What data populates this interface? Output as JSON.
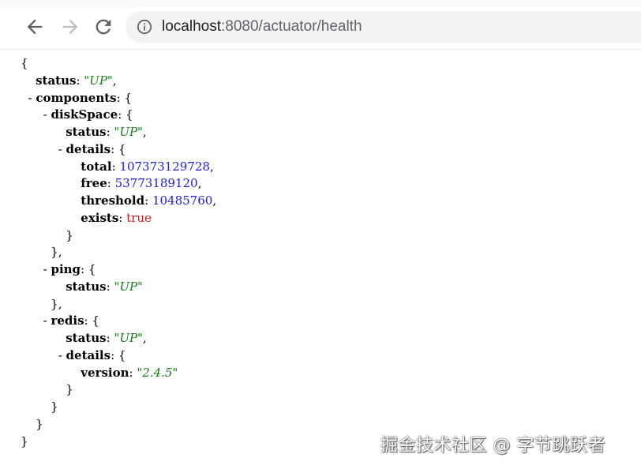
{
  "browser": {
    "url_host": "localhost",
    "url_rest": ":8080/actuator/health"
  },
  "json": {
    "open_brace": "{",
    "status_key": "status",
    "status_value": "\"UP\"",
    "toggle": "- ",
    "components_key": "components",
    "diskSpace": {
      "key": "diskSpace",
      "status_key": "status",
      "status_value": "\"UP\"",
      "details_key": "details",
      "total_key": "total",
      "total_value": "107373129728",
      "free_key": "free",
      "free_value": "53773189120",
      "threshold_key": "threshold",
      "threshold_value": "10485760",
      "exists_key": "exists",
      "exists_value": "true"
    },
    "ping": {
      "key": "ping",
      "status_key": "status",
      "status_value": "\"UP\""
    },
    "redis": {
      "key": "redis",
      "status_key": "status",
      "status_value": "\"UP\"",
      "details_key": "details",
      "version_key": "version",
      "version_value": "\"2.4.5\""
    },
    "close_brace": "}"
  },
  "watermark": "掘金技术社区 @ 字节跳跃者"
}
